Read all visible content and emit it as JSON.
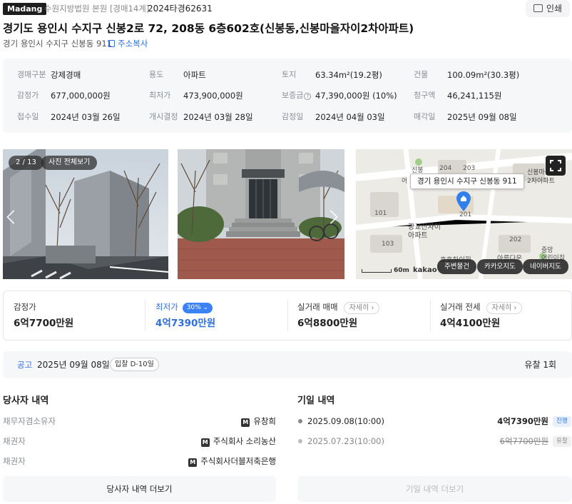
{
  "header": {
    "brand": "Madang",
    "court": "수원지방법원 본원 [경매14계]",
    "case_number": "2024타경62631",
    "print_label": "인쇄"
  },
  "property": {
    "title": "경기도 용인시 수지구 신봉2로 72, 208동 6층602호(신봉동,신봉마을자이2차아파트)",
    "lot_address": "경기 용인시 수지구 신봉동 911",
    "copy_label": "주소복사"
  },
  "info": {
    "auction_type_label": "경매구분",
    "auction_type": "강제경매",
    "use_label": "용도",
    "use": "아파트",
    "land_label": "토지",
    "land": "63.34m²(19.2평)",
    "building_label": "건물",
    "building": "100.09m²(30.3평)",
    "appraisal_label": "감정가",
    "appraisal": "677,000,000원",
    "minimum_label": "최저가",
    "minimum": "473,900,000원",
    "deposit_label": "보증금",
    "deposit": "47,390,000원 (10%)",
    "claim_label": "청구액",
    "claim": "46,241,115원",
    "received_label": "접수일",
    "received": "2024년 03월 26일",
    "commenced_label": "개시결정",
    "commenced": "2024년 03월 28일",
    "appraised_label": "감정일",
    "appraised": "2024년 04월 03일",
    "sale_label": "매각일",
    "sale": "2025년 09월 08일"
  },
  "photos": {
    "counter": "2 / 13",
    "view_all": "사진 전체보기"
  },
  "map": {
    "popup": "경기 용인시 수지구 신봉동 911",
    "scale": "60m",
    "provider": "kakao",
    "labels": {
      "n204": "204",
      "n203": "203",
      "n101": "101",
      "n103": "103",
      "n202": "202",
      "n201": "201",
      "sinbong": "신봉",
      "eo": "어",
      "apt_r1": "신봉마을",
      "apt_r2": "2차아파트",
      "gwang1": "광교산자이",
      "gwang2": "아파트",
      "hohoho": "호호하이원",
      "areum": "아름다운",
      "jung1": "중망",
      "jung2": "어린이집"
    },
    "buttons": [
      "주변물건",
      "카카오지도",
      "네이버지도"
    ]
  },
  "prices": {
    "appraisal_label": "감정가",
    "appraisal": "6억7700만원",
    "minimum_label": "최저가",
    "minimum_rate": "30%",
    "minimum": "4억7390만원",
    "trade_label": "실거래 매매",
    "trade": "6억8800만원",
    "rent_label": "실거래 전세",
    "rent": "4억4100만원",
    "detail": "자세히"
  },
  "notice": {
    "label": "공고",
    "date": "2025년 09월 08일",
    "dday": "입찰 D-10일",
    "fail_count": "유찰 1회"
  },
  "parties": {
    "title": "당사자 내역",
    "rows": [
      {
        "role": "채무자겸소유자",
        "name": "유창희"
      },
      {
        "role": "채권자",
        "name": "주식회사 소리농산"
      },
      {
        "role": "채권자",
        "name": "주식회사더블저축은행"
      }
    ],
    "more": "당사자 내역 더보기",
    "badge": "M"
  },
  "history": {
    "title": "기일 내역",
    "rows": [
      {
        "date": "2025.09.08(10:00)",
        "price": "4억7390만원",
        "status": "진행"
      },
      {
        "date": "2025.07.23(10:00)",
        "price": "6억7700만원",
        "status": "유찰"
      }
    ],
    "more": "기일 내역 더보기"
  },
  "colors": {
    "accent": "#2f6fdf",
    "badge_blue": "#3b82f6",
    "panel": "#f6f7f9"
  }
}
